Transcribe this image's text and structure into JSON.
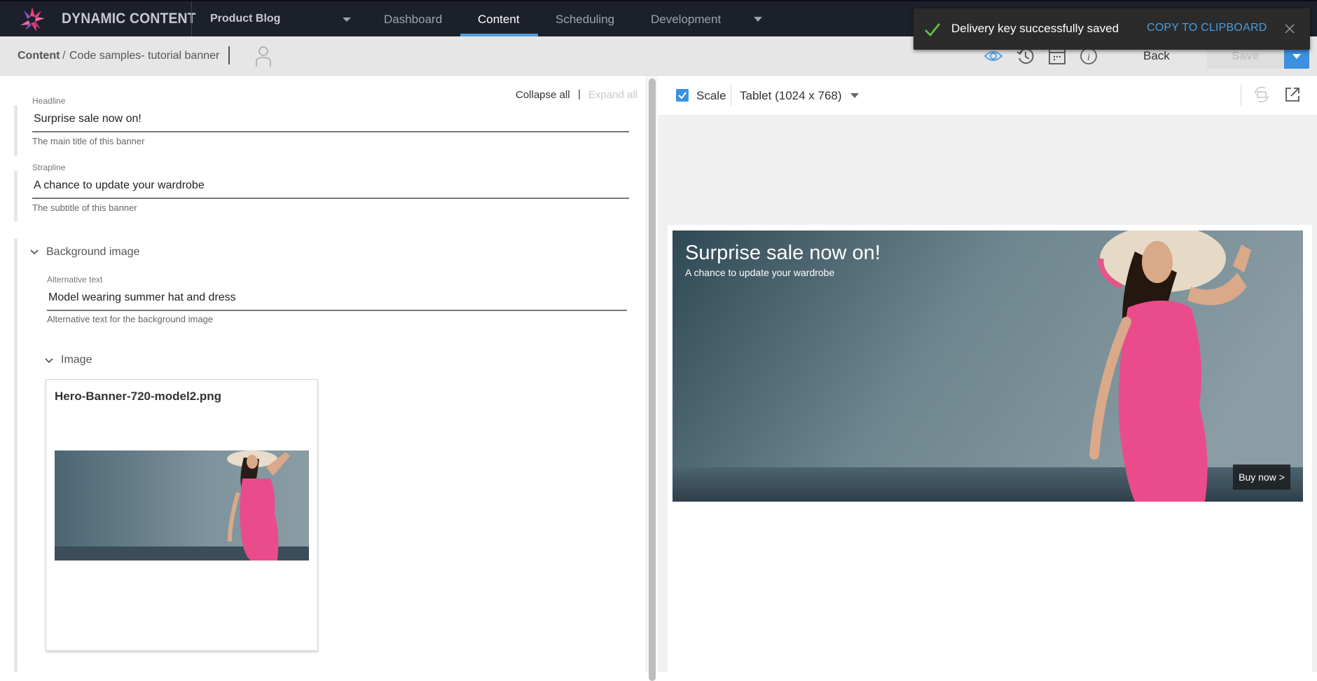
{
  "app": {
    "brand": "DYNAMIC CONTENT",
    "hub": "Product Blog",
    "nav": [
      {
        "label": "Dashboard",
        "active": false
      },
      {
        "label": "Content",
        "active": true
      },
      {
        "label": "Scheduling",
        "active": false
      },
      {
        "label": "Development",
        "active": false
      }
    ],
    "accent_color": "#4a9de0"
  },
  "breadcrumb": {
    "root": "Content",
    "separator": "/",
    "item": "Code samples- tutorial banner"
  },
  "toolbar": {
    "icons": [
      "eye-icon",
      "history-icon",
      "calendar-icon",
      "info-icon"
    ],
    "back_label": "Back",
    "save_label": "Save"
  },
  "toast": {
    "message": "Delivery key successfully saved",
    "action": "COPY TO CLIPBOARD",
    "status_color": "#6cc04a"
  },
  "editor": {
    "collapse_all": "Collapse all",
    "separator": "|",
    "expand_all": "Expand all",
    "fields": {
      "headline": {
        "label": "Headline",
        "value": "Surprise sale now on!",
        "help": "The main title of this banner"
      },
      "strapline": {
        "label": "Strapline",
        "value": "A chance to update your wardrobe",
        "help": "The subtitle of this banner"
      }
    },
    "background_image": {
      "title": "Background image",
      "alt_text": {
        "label": "Alternative text",
        "value": "Model wearing summer hat and dress",
        "help": "Alternative text for the background image"
      },
      "image": {
        "title": "Image",
        "asset_name": "Hero-Banner-720-model2.png"
      }
    }
  },
  "preview": {
    "scale_label": "Scale",
    "scale_checked": true,
    "device": "Tablet (1024 x 768)",
    "banner": {
      "headline": "Surprise sale now on!",
      "strapline": "A chance to update your wardrobe",
      "cta": "Buy now >"
    }
  }
}
